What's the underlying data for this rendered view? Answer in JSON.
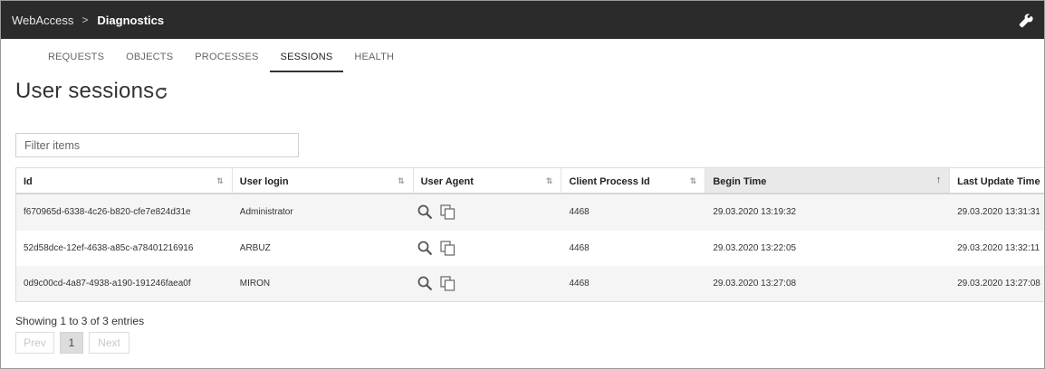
{
  "header": {
    "breadcrumb_root": "WebAccess",
    "breadcrumb_separator": ">",
    "breadcrumb_current": "Diagnostics",
    "tools_icon": "wrench-icon"
  },
  "tabs": [
    {
      "label": "REQUESTS"
    },
    {
      "label": "OBJECTS"
    },
    {
      "label": "PROCESSES"
    },
    {
      "label": "SESSIONS",
      "active": true
    },
    {
      "label": "HEALTH"
    }
  ],
  "page": {
    "title": "User sessions",
    "refresh_icon": "refresh-icon"
  },
  "filter": {
    "placeholder": "Filter items",
    "value": ""
  },
  "table": {
    "columns": [
      {
        "label": "Id",
        "sort": "none"
      },
      {
        "label": "User login",
        "sort": "none"
      },
      {
        "label": "User Agent",
        "sort": "none"
      },
      {
        "label": "Client Process Id",
        "sort": "none"
      },
      {
        "label": "Begin Time",
        "sort": "ascending"
      },
      {
        "label": "Last Update Time",
        "sort": "none"
      }
    ],
    "rows": [
      {
        "id": "f670965d-6338-4c26-b820-cfe7e824d31e",
        "login": "Administrator",
        "pid": "4468",
        "begin": "29.03.2020 13:19:32",
        "update": "29.03.2020 13:31:31"
      },
      {
        "id": "52d58dce-12ef-4638-a85c-a78401216916",
        "login": "ARBUZ",
        "pid": "4468",
        "begin": "29.03.2020 13:22:05",
        "update": "29.03.2020 13:32:11"
      },
      {
        "id": "0d9c00cd-4a87-4938-a190-191246faea0f",
        "login": "MIRON",
        "pid": "4468",
        "begin": "29.03.2020 13:27:08",
        "update": "29.03.2020 13:27:08"
      }
    ],
    "agent_icons": [
      "search-icon",
      "copy-icon"
    ]
  },
  "footer": {
    "info": "Showing 1 to 3 of 3 entries",
    "prev_label": "Prev",
    "page_label": "1",
    "next_label": "Next"
  },
  "colors": {
    "topbar": "#2b2b2b",
    "row_stripe": "#f5f5f5",
    "sorted_header": "#e9e9e9"
  }
}
